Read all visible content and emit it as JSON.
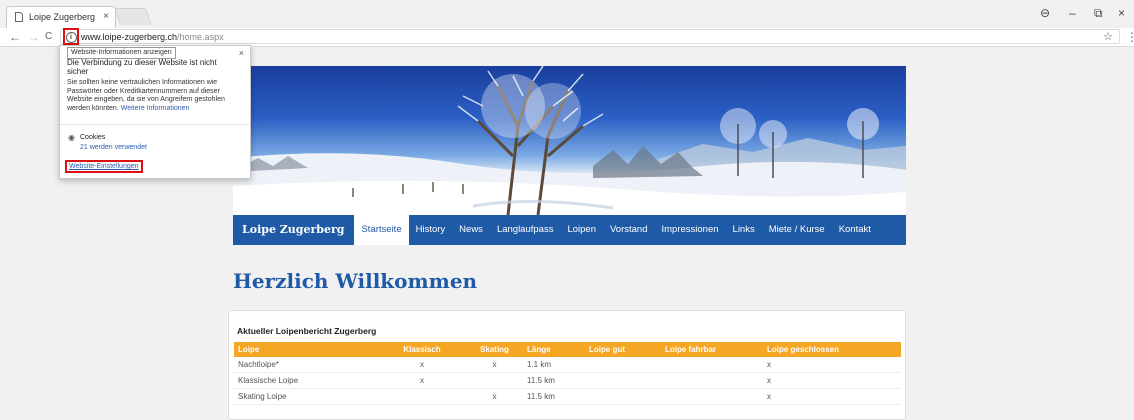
{
  "browser": {
    "tab_title": "Loipe Zugerberg - Startse",
    "tab_close": "×",
    "url_host": "www.loipe-zugerberg.ch",
    "url_path": "/home.aspx",
    "nav": {
      "back": "←",
      "forward": "→",
      "reload": "C"
    },
    "window_controls": {
      "account": "⊖",
      "minimize": "–",
      "maximize": "⧉",
      "close": "×"
    },
    "star": "☆",
    "menu": "⋮",
    "info_icon": "i"
  },
  "site_info": {
    "tooltip": "Website-Informationen anzeigen",
    "close": "×",
    "heading": "Die Verbindung zu dieser Website ist nicht sicher",
    "body": "Sie sollten keine vertraulichen Informationen wie Passwörter oder Kreditkartennummern auf dieser Website eingeben, da sie von Angreifern gestohlen werden könnten.",
    "more_link": "Weitere Informationen",
    "cookies_label": "Cookies",
    "cookies_sub": "21 werden verwendet",
    "settings_link": "Website-Einstellungen"
  },
  "navbar": {
    "brand": "Loipe Zugerberg",
    "items": [
      "Startseite",
      "History",
      "News",
      "Langlaufpass",
      "Loipen",
      "Vorstand",
      "Impressionen",
      "Links",
      "Miete / Kurse",
      "Kontakt"
    ],
    "active": "Startseite"
  },
  "main": {
    "welcome": "Herzlich Willkommen",
    "report_title": "Aktueller Loipenbericht Zugerberg",
    "table": {
      "headers": [
        "Loipe",
        "Klassisch",
        "Skating",
        "Länge",
        "Loipe gut",
        "Loipe fahrbar",
        "Loipe geschlossen"
      ],
      "rows": [
        [
          "Nachtloipe*",
          "x",
          "x",
          "1.1 km",
          "",
          "",
          "x"
        ],
        [
          "Klassische Loipe",
          "x",
          "",
          "11.5 km",
          "",
          "",
          "x"
        ],
        [
          "Skating Loipe",
          "",
          "x",
          "11.5 km",
          "",
          "",
          "x"
        ]
      ]
    }
  },
  "colors": {
    "brand_blue": "#1f5aa6",
    "table_header_orange": "#f5a623",
    "highlight_red": "#dd1111"
  }
}
